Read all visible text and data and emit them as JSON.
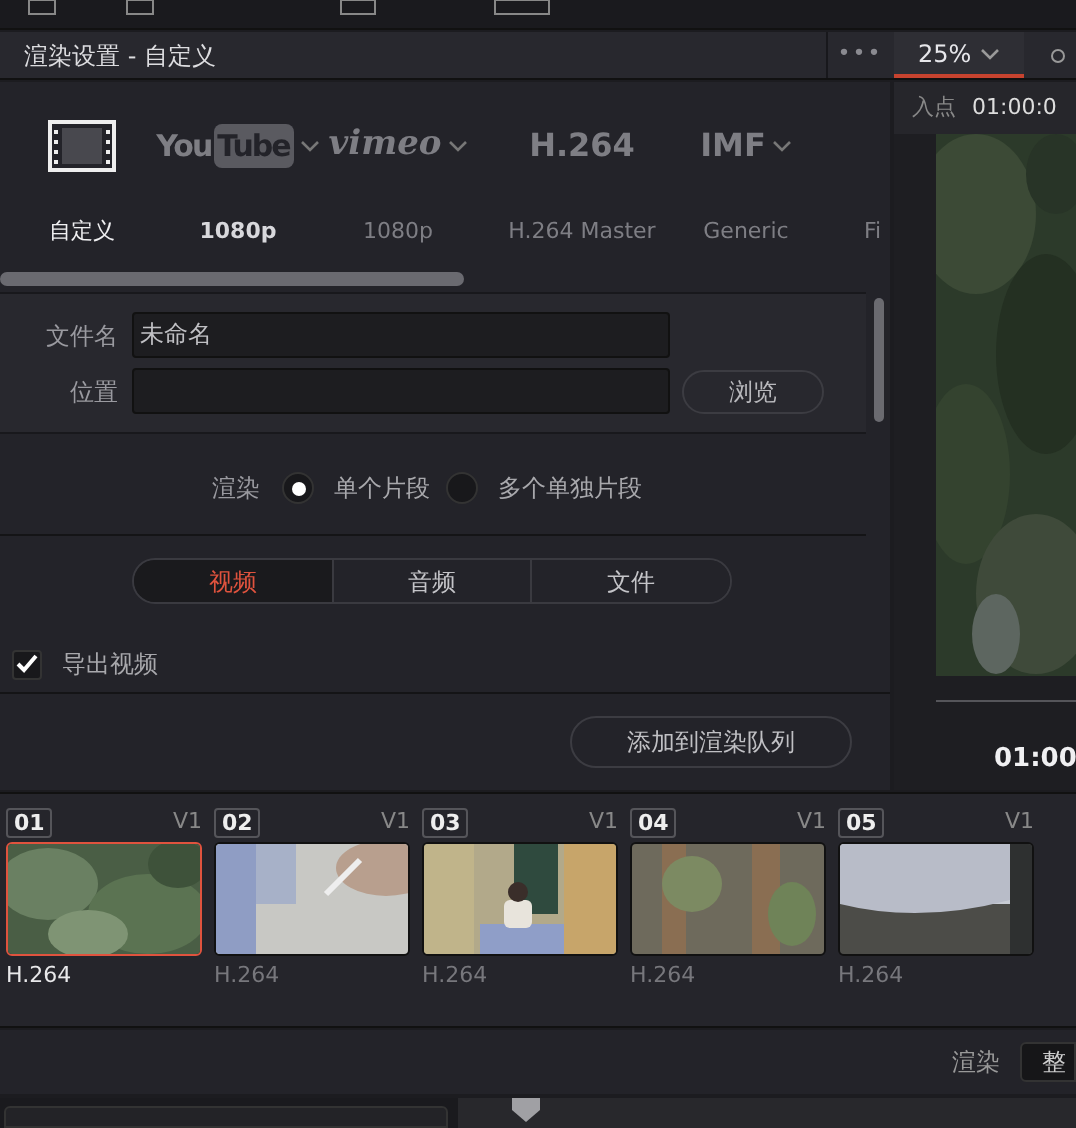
{
  "panel": {
    "title": "渲染设置 - 自定义",
    "more": "•••"
  },
  "viewer": {
    "zoom": "25%",
    "in_label": "入点",
    "in_time": "01:00:0",
    "timecode": "01:00"
  },
  "presets": [
    {
      "kind": "film",
      "label": "自定义",
      "selected": true,
      "menu": false
    },
    {
      "kind": "youtube",
      "logo": [
        "You",
        "Tube"
      ],
      "label": "1080p",
      "selected": false,
      "menu": true
    },
    {
      "kind": "vimeo",
      "logo": [
        "vimeo"
      ],
      "label": "1080p",
      "selected": false,
      "menu": true
    },
    {
      "kind": "text",
      "logo": [
        "H.264"
      ],
      "label": "H.264 Master",
      "selected": false,
      "menu": false
    },
    {
      "kind": "text",
      "logo": [
        "IMF"
      ],
      "label": "Generic",
      "selected": false,
      "menu": true
    },
    {
      "kind": "cut",
      "label": "Fi",
      "selected": false,
      "menu": false
    }
  ],
  "form": {
    "filename_label": "文件名",
    "filename": "未命名",
    "location_label": "位置",
    "browse": "浏览"
  },
  "render_mode": {
    "label": "渲染",
    "options": [
      {
        "label": "单个片段",
        "selected": true
      },
      {
        "label": "多个单独片段",
        "selected": false
      }
    ]
  },
  "tabs": [
    {
      "label": "视频",
      "selected": true
    },
    {
      "label": "音频",
      "selected": false
    },
    {
      "label": "文件",
      "selected": false
    }
  ],
  "export_video": {
    "label": "导出视频",
    "checked": true
  },
  "add_button": "添加到渲染队列",
  "clips": [
    {
      "index": "01",
      "track": "V1",
      "codec": "H.264",
      "selected": true
    },
    {
      "index": "02",
      "track": "V1",
      "codec": "H.264",
      "selected": false
    },
    {
      "index": "03",
      "track": "V1",
      "codec": "H.264",
      "selected": false
    },
    {
      "index": "04",
      "track": "V1",
      "codec": "H.264",
      "selected": false
    },
    {
      "index": "05",
      "track": "V1",
      "codec": "H.264",
      "selected": false
    }
  ],
  "render_bar": {
    "label": "渲染",
    "value": "整"
  }
}
